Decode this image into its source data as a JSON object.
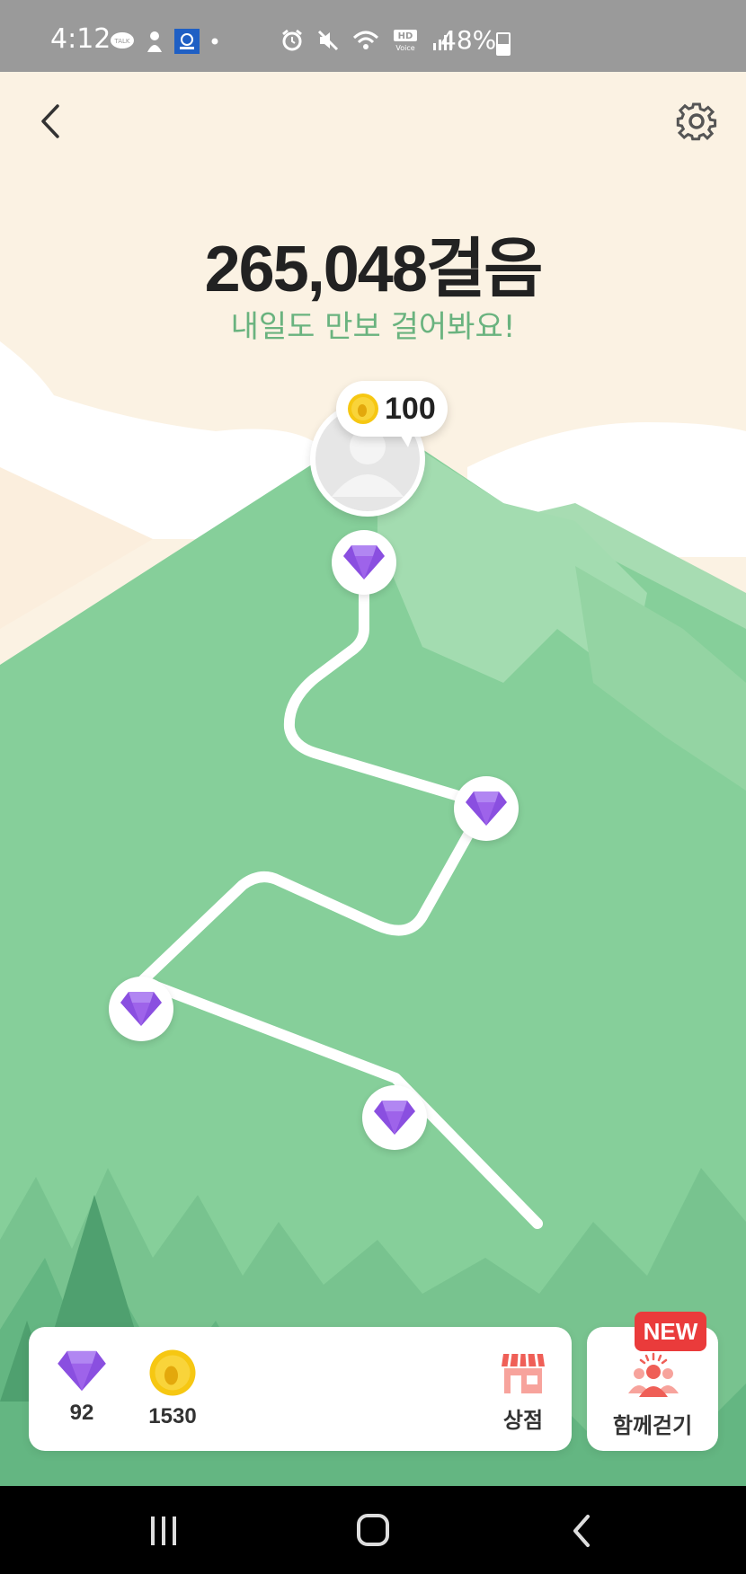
{
  "status_bar": {
    "time": "4:12",
    "battery_percent": "48%",
    "icons": [
      "kakaotalk-icon",
      "person-icon",
      "app-icon",
      "dot-icon",
      "alarm-icon",
      "mute-icon",
      "wifi-icon",
      "hd-voice-icon",
      "signal-icon",
      "battery-icon"
    ]
  },
  "header": {
    "back_icon": "chevron-left-icon",
    "settings_icon": "gear-icon"
  },
  "steps": {
    "total": "265,048걸음",
    "subtitle": "내일도 만보 걸어봐요!"
  },
  "profile": {
    "coin_amount": "100",
    "coin_icon": "footprint-coin-icon"
  },
  "path": {
    "node_icon": "diamond-icon",
    "node_count": 4
  },
  "inventory": {
    "diamonds": "92",
    "coins": "1530",
    "shop_label": "상점",
    "together_label": "함께걷기",
    "new_badge": "NEW"
  },
  "colors": {
    "sky": "#fbf2e3",
    "mountain_light": "#9dd8a9",
    "mountain_main": "#86cf9a",
    "forest_dark": "#5bae79",
    "subtitle_green": "#6ab37f",
    "diamond_purple": "#8a4fe0",
    "coin_yellow": "#f6c712",
    "badge_red": "#ea3b3b"
  }
}
